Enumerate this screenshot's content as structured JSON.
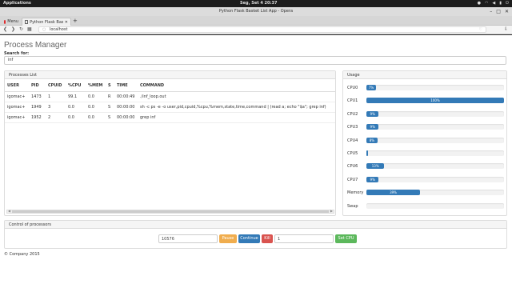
{
  "system_bar": {
    "applications": "Applications",
    "clock": "Seg, Set  4   20:37"
  },
  "window": {
    "title": "Python Flask Basket List App - Opera"
  },
  "tabs": {
    "menu_label": "Menu",
    "active_tab": "Python Flask Basket List",
    "new_tab": "+"
  },
  "address": {
    "url": "localhost"
  },
  "page": {
    "title": "Process Manager",
    "search_label": "Search for:",
    "search_value": "inf",
    "processes_heading": "Processes List",
    "usage_heading": "Usage",
    "control_heading": "Control of processors",
    "footer": "© Company 2015"
  },
  "table": {
    "columns": [
      "USER",
      "PID",
      "CPUID",
      "%CPU",
      "%MEM",
      "S",
      "TIME",
      "COMMAND"
    ],
    "rows": [
      [
        "igomac+",
        "1473",
        "1",
        "99.1",
        "0.0",
        "R",
        "00:00:49",
        "./inf_loop.out"
      ],
      [
        "igomac+",
        "1949",
        "3",
        "0.0",
        "0.0",
        "S",
        "00:00:00",
        "sh -c ps -e -o user,pid,cpuid,%cpu,%mem,state,time,command | (read a; echo \"$a\"; grep inf)"
      ],
      [
        "igomac+",
        "1952",
        "2",
        "0.0",
        "0.0",
        "S",
        "00:00:00",
        "grep inf"
      ]
    ]
  },
  "usage": [
    {
      "label": "CPU0",
      "value": 7,
      "text": "7%"
    },
    {
      "label": "CPU1",
      "value": 100,
      "text": "100%"
    },
    {
      "label": "CPU2",
      "value": 9,
      "text": "9%"
    },
    {
      "label": "CPU3",
      "value": 9,
      "text": "9%"
    },
    {
      "label": "CPU4",
      "value": 8,
      "text": "8%"
    },
    {
      "label": "CPU5",
      "value": 1,
      "text": ""
    },
    {
      "label": "CPU6",
      "value": 13,
      "text": "13%"
    },
    {
      "label": "CPU7",
      "value": 9,
      "text": "9%"
    },
    {
      "label": "Memory",
      "value": 39,
      "text": "39%"
    },
    {
      "label": "Swap",
      "value": 0,
      "text": ""
    }
  ],
  "control": {
    "pid_value": "10576",
    "pause": "Pause",
    "continue": "Continue",
    "kill": "Kill",
    "cpu_value": "1",
    "set_cpu": "Set CPU"
  },
  "colors": {
    "bar": "#337ab7",
    "pause": "#f0ad4e",
    "continue": "#337ab7",
    "kill": "#d9534f",
    "set_cpu": "#5cb85c"
  }
}
